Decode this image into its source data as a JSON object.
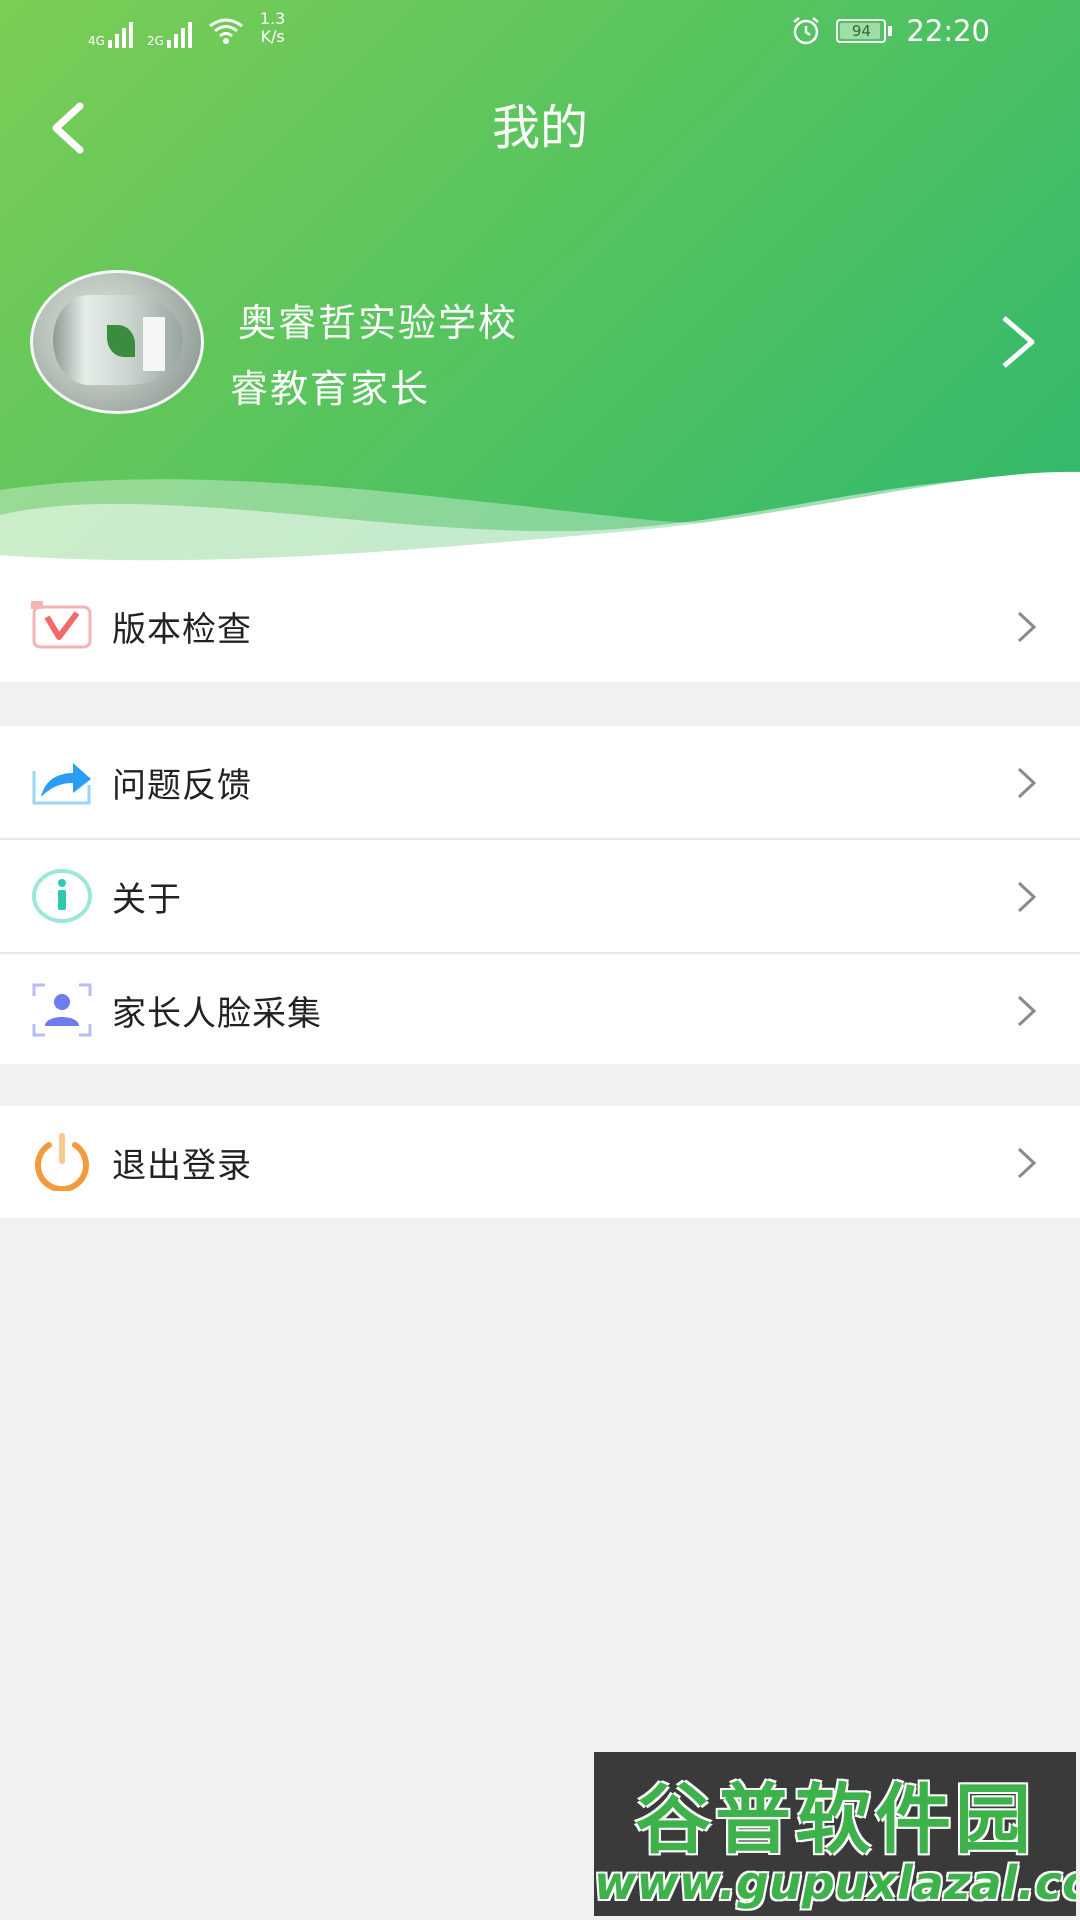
{
  "status_bar": {
    "network1": "4G",
    "network2": "2G",
    "speed_value": "1.3",
    "speed_unit": "K/s",
    "battery": "94",
    "time": "22:20"
  },
  "header": {
    "title": "我的"
  },
  "profile": {
    "school": "奥睿哲实验学校",
    "role": "睿教育家长"
  },
  "menu": {
    "group1": [
      {
        "label": "版本检查",
        "icon": "version-check-icon"
      }
    ],
    "group2": [
      {
        "label": "问题反馈",
        "icon": "feedback-share-icon"
      },
      {
        "label": "关于",
        "icon": "info-icon"
      },
      {
        "label": "家长人脸采集",
        "icon": "face-capture-icon"
      }
    ],
    "group3": [
      {
        "label": "退出登录",
        "icon": "power-icon"
      }
    ]
  },
  "watermark": {
    "title": "谷普软件园",
    "url": "www.gupuxlazal.com"
  },
  "colors": {
    "header_start": "#7ccd55",
    "header_end": "#2fb86c",
    "background": "#f1f1f1",
    "version_icon": "#f06a6a",
    "feedback_icon": "#2a9df4",
    "info_icon": "#32c7b0",
    "face_icon": "#6f7cf0",
    "power_icon": "#f39a3c"
  }
}
